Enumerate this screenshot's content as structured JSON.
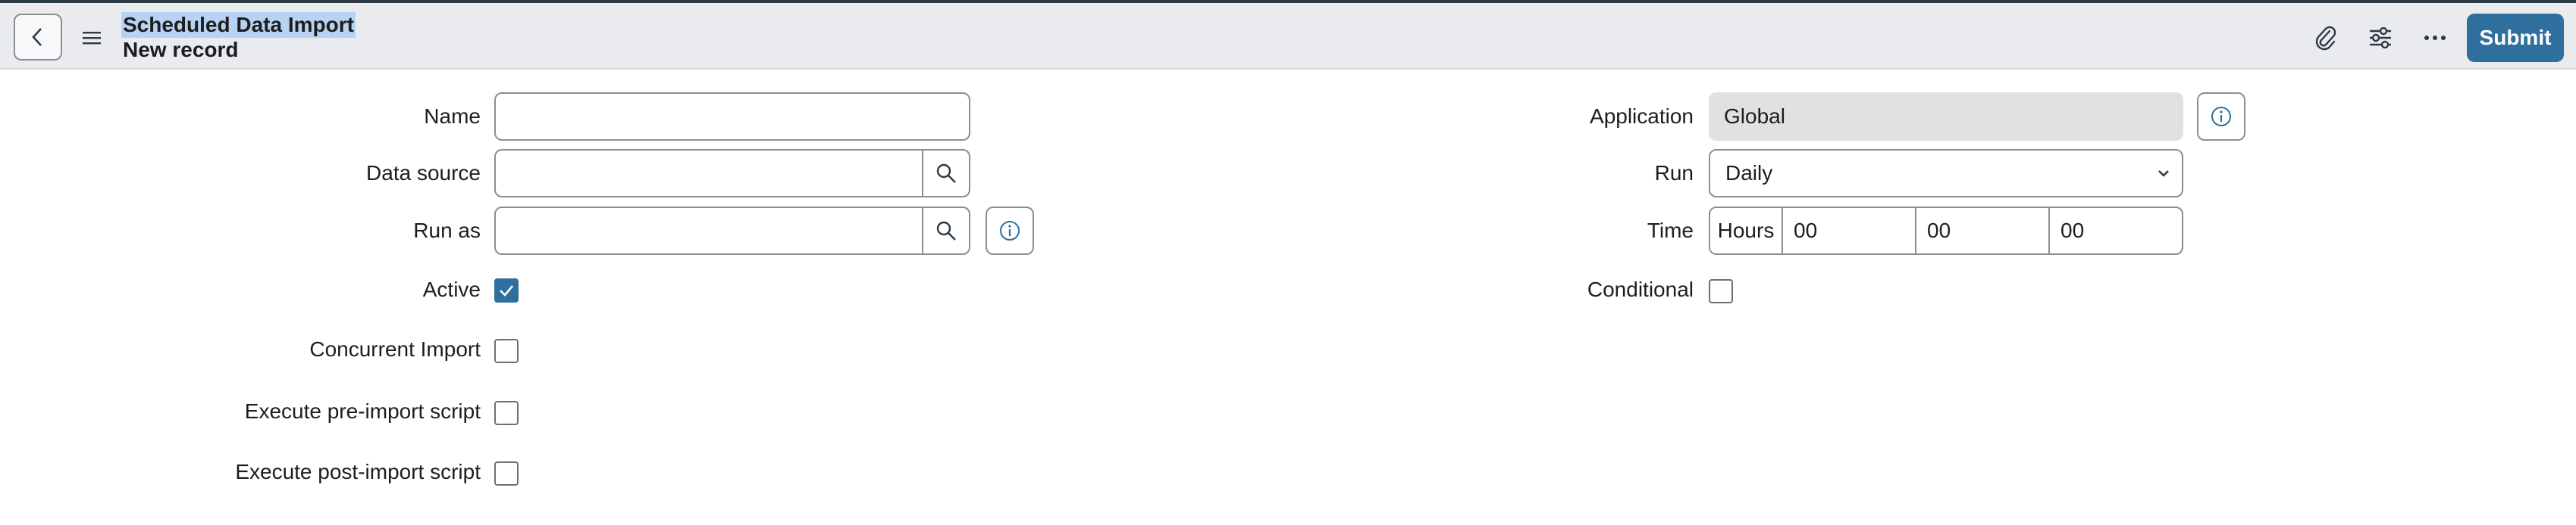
{
  "header": {
    "title": "Scheduled Data Import",
    "subtitle": "New record",
    "submit_label": "Submit"
  },
  "form": {
    "left": {
      "name_label": "Name",
      "name_value": "",
      "data_source_label": "Data source",
      "data_source_value": "",
      "run_as_label": "Run as",
      "run_as_value": "",
      "active_label": "Active",
      "active_checked": true,
      "concurrent_label": "Concurrent Import",
      "concurrent_checked": false,
      "pre_script_label": "Execute pre-import script",
      "pre_script_checked": false,
      "post_script_label": "Execute post-import script",
      "post_script_checked": false
    },
    "right": {
      "application_label": "Application",
      "application_value": "Global",
      "run_label": "Run",
      "run_value": "Daily",
      "time_label": "Time",
      "time_prefix": "Hours",
      "time_hours": "00",
      "time_minutes": "00",
      "time_seconds": "00",
      "conditional_label": "Conditional",
      "conditional_checked": false
    }
  },
  "colors": {
    "accent": "#2f6f9d",
    "header_bg": "#e9ebee",
    "title_highlight": "#b8d2f3",
    "border": "#8a8f94",
    "readonly_bg": "#dfe1e3"
  },
  "icons": [
    "back-icon",
    "menu-icon",
    "paperclip-icon",
    "sliders-icon",
    "more-icon",
    "search-icon",
    "info-icon",
    "check-icon",
    "chevron-down-icon"
  ]
}
